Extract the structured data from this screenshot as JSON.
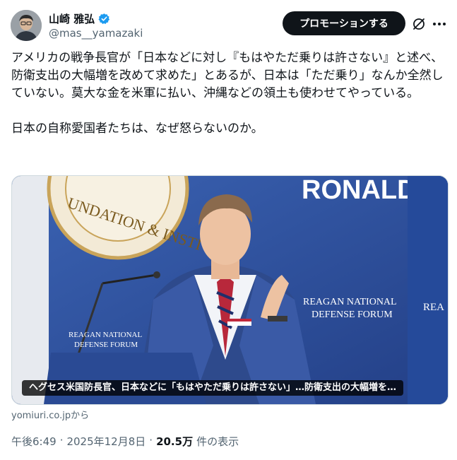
{
  "author": {
    "display_name": "山崎 雅弘",
    "handle": "@mas__yamazaki",
    "verified_color": "#1d9bf0"
  },
  "header": {
    "promo_label": "プロモーションする",
    "grok_icon": "grok-slash-icon",
    "more_icon": "more-dots-icon"
  },
  "tweet": {
    "text": "アメリカの戦争長官が「日本などに対し『もはやただ乗りは許さない』と述べ、防衛支出の大幅増を改めて求めた」とあるが、日本は「ただ乗り」なんか全然していない。莫大な金を米軍に払い、沖縄などの領土も使わせてやっている。\n\n日本の自称愛国者たちは、なぜ怒らないのか。"
  },
  "media": {
    "caption": "ヘグセス米国防長官、日本などに「もはやただ乗りは許さない」…防衛支出の大幅増を…",
    "backdrop_text": {
      "banner_top": "RONALD",
      "seal_text": "UNDATION & INSTI",
      "podium_line1": "REAGAN NATIONAL",
      "podium_line2": "DEFENSE FORUM",
      "right_line1": "REAGAN NATIONAL",
      "right_line2": "DEFENSE FORUM",
      "right_edge": "REA"
    }
  },
  "source": {
    "label": "yomiuri.co.jpから"
  },
  "meta": {
    "time": "午後6:49",
    "sep1": "·",
    "date": "2025年12月8日",
    "sep2": "·",
    "views": "20.5万",
    "views_label": "件の表示"
  }
}
